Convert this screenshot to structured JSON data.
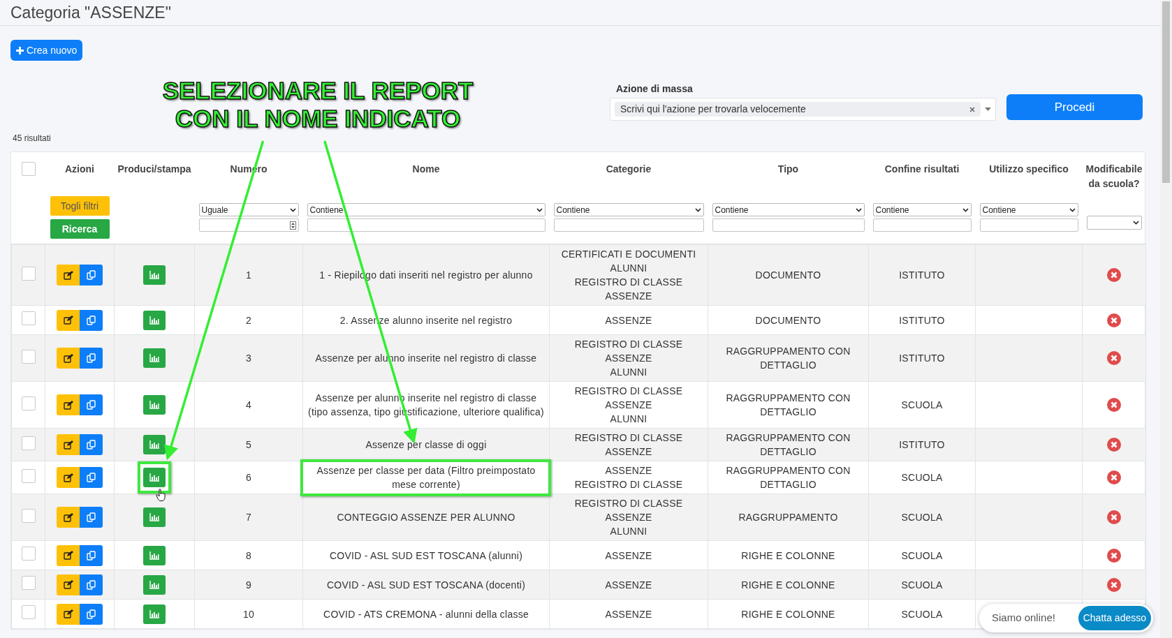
{
  "page_title": "Categoria \"ASSENZE\"",
  "create_button": {
    "label": "Crea nuovo"
  },
  "mass_action": {
    "label": "Azione di massa",
    "value": "Scrivi qui l'azione per trovarla velocemente",
    "submit": "Procedi"
  },
  "result_count": "45 risultati",
  "annotation": {
    "lines": [
      "SELEZIONARE IL REPORT",
      "CON IL NOME INDICATO"
    ]
  },
  "table": {
    "all_selected": false,
    "columns": [
      "Azioni",
      "Produci/stampa",
      "Numero",
      "Nome",
      "Categorie",
      "Tipo",
      "Confine risultati",
      "Utilizzo specifico",
      "Modificabile da scuola?"
    ],
    "filter_buttons": {
      "clear": "Togli filtri",
      "search": "Ricerca"
    },
    "filters": [
      {
        "kind": "number",
        "operator": "Uguale"
      },
      {
        "kind": "text",
        "operator": "Contiene"
      },
      {
        "kind": "text",
        "operator": "Contiene"
      },
      {
        "kind": "text",
        "operator": "Contiene"
      },
      {
        "kind": "text",
        "operator": "Contiene"
      },
      {
        "kind": "text",
        "operator": "Contiene"
      },
      {
        "kind": "choice"
      }
    ],
    "rows": [
      {
        "selected": false,
        "number": "1",
        "name": "1 - Riepilogo dati inseriti nel registro per alunno",
        "categories": [
          "CERTIFICATI E DOCUMENTI",
          "ALUNNI",
          "REGISTRO DI CLASSE",
          "ASSENZE"
        ],
        "type": "DOCUMENTO",
        "scope": "ISTITUTO",
        "editable_by_school": false,
        "highlighted": false
      },
      {
        "selected": false,
        "number": "2",
        "name": "2. Assenze alunno inserite nel registro",
        "categories": [
          "ASSENZE"
        ],
        "type": "DOCUMENTO",
        "scope": "ISTITUTO",
        "editable_by_school": false,
        "highlighted": false
      },
      {
        "selected": false,
        "number": "3",
        "name": "Assenze per alunno inserite nel registro di classe",
        "categories": [
          "REGISTRO DI CLASSE",
          "ASSENZE",
          "ALUNNI"
        ],
        "type": "RAGGRUPPAMENTO CON DETTAGLIO",
        "scope": "ISTITUTO",
        "editable_by_school": false,
        "highlighted": false
      },
      {
        "selected": false,
        "number": "4",
        "name": "Assenze per alunno inserite nel registro di classe (tipo assenza, tipo giustificazione, ulteriore qualifica)",
        "categories": [
          "REGISTRO DI CLASSE",
          "ASSENZE",
          "ALUNNI"
        ],
        "type": "RAGGRUPPAMENTO CON DETTAGLIO",
        "scope": "SCUOLA",
        "editable_by_school": false,
        "highlighted": false
      },
      {
        "selected": false,
        "number": "5",
        "name": "Assenze per classe di oggi",
        "categories": [
          "REGISTRO DI CLASSE",
          "ASSENZE"
        ],
        "type": "RAGGRUPPAMENTO CON DETTAGLIO",
        "scope": "ISTITUTO",
        "editable_by_school": false,
        "highlighted": false
      },
      {
        "selected": false,
        "number": "6",
        "name": "Assenze per classe per data (Filtro preimpostato mese corrente)",
        "categories": [
          "ASSENZE",
          "REGISTRO DI CLASSE"
        ],
        "type": "RAGGRUPPAMENTO CON DETTAGLIO",
        "scope": "SCUOLA",
        "editable_by_school": false,
        "highlighted": true
      },
      {
        "selected": false,
        "number": "7",
        "name": "CONTEGGIO ASSENZE PER ALUNNO",
        "categories": [
          "REGISTRO DI CLASSE",
          "ASSENZE",
          "ALUNNI"
        ],
        "type": "RAGGRUPPAMENTO",
        "scope": "SCUOLA",
        "editable_by_school": false,
        "highlighted": false
      },
      {
        "selected": false,
        "number": "8",
        "name": "COVID - ASL SUD EST TOSCANA (alunni)",
        "categories": [
          "ASSENZE"
        ],
        "type": "RIGHE E COLONNE",
        "scope": "SCUOLA",
        "editable_by_school": false,
        "highlighted": false
      },
      {
        "selected": false,
        "number": "9",
        "name": "COVID - ASL SUD EST TOSCANA (docenti)",
        "categories": [
          "ASSENZE"
        ],
        "type": "RIGHE E COLONNE",
        "scope": "SCUOLA",
        "editable_by_school": false,
        "highlighted": false
      },
      {
        "selected": false,
        "number": "10",
        "name": "COVID - ATS CREMONA - alunni della classe",
        "categories": [
          "ASSENZE"
        ],
        "type": "RIGHE E COLONNE",
        "scope": "SCUOLA",
        "highlighted": false
      }
    ]
  },
  "chat": {
    "status": "Siamo online!",
    "button": "Chatta adesso"
  }
}
